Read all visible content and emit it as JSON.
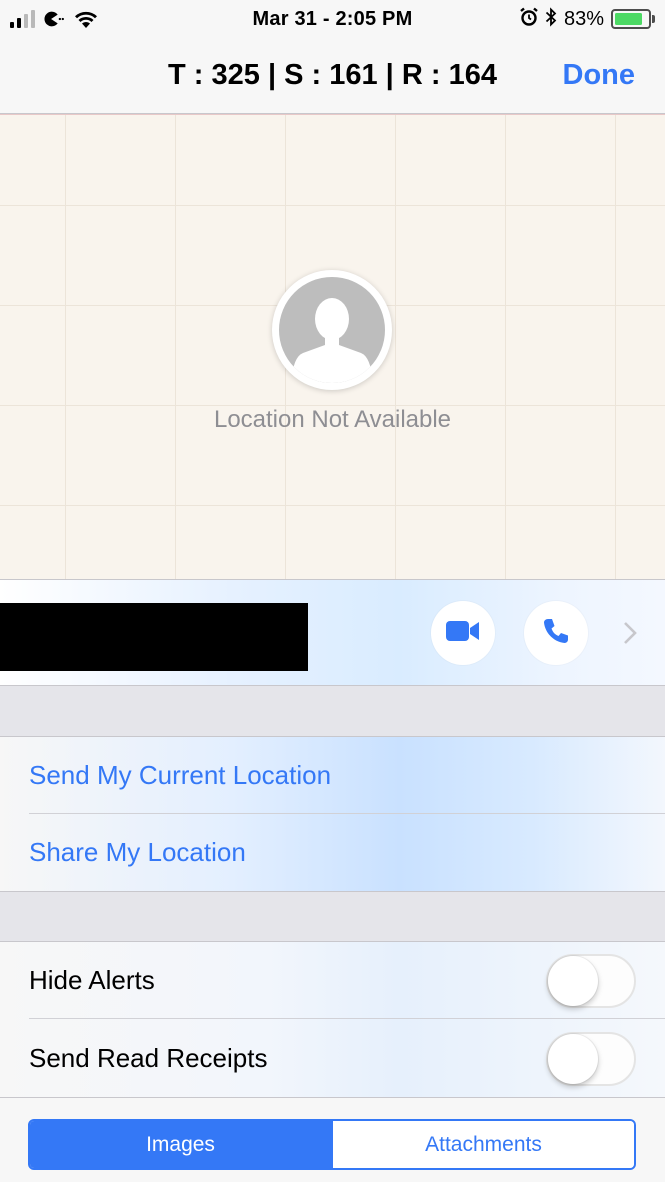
{
  "status_bar": {
    "time": "Mar 31 - 2:05 PM",
    "battery_percent_label": "83%",
    "battery_level": 0.83,
    "signal_bars_filled": 2,
    "signal_bars_total": 4
  },
  "nav": {
    "title": "T : 325 | S : 161 | R : 164",
    "done_label": "Done"
  },
  "map": {
    "location_label": "Location Not Available"
  },
  "contact": {
    "video_icon": "video-camera-icon",
    "phone_icon": "phone-icon",
    "chevron_icon": "chevron-right-icon"
  },
  "location_actions": {
    "send_current_location": "Send My Current Location",
    "share_location": "Share My Location"
  },
  "settings": {
    "hide_alerts_label": "Hide Alerts",
    "hide_alerts_on": false,
    "read_receipts_label": "Send Read Receipts",
    "read_receipts_on": false
  },
  "segments": {
    "images": "Images",
    "attachments": "Attachments",
    "selected": "Images"
  },
  "colors": {
    "accent": "#3478f6",
    "battery_green": "#4cd964"
  }
}
